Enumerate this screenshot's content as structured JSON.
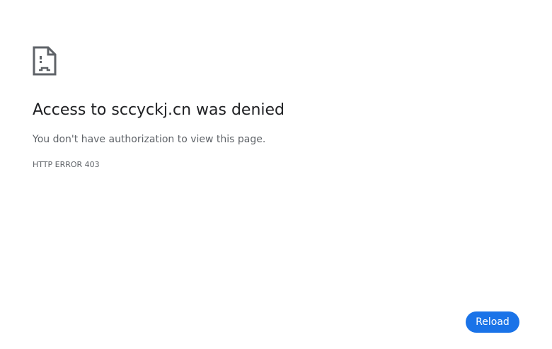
{
  "error": {
    "icon": "sad-page-icon",
    "heading": "Access to sccyckj.cn was denied",
    "message": "You don't have authorization to view this page.",
    "code": "HTTP ERROR 403"
  },
  "actions": {
    "reload_label": "Reload"
  },
  "colors": {
    "text": "#202124",
    "secondary_text": "#5f6368",
    "icon": "#5f6368",
    "button": "#1a73e8",
    "button_text": "#ffffff",
    "background": "#ffffff"
  }
}
